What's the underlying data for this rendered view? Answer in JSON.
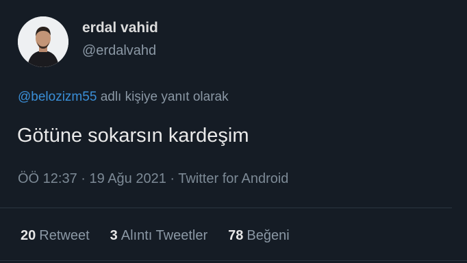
{
  "user": {
    "display_name": "erdal vahid",
    "handle": "@erdalvahd"
  },
  "reply": {
    "mention": "@belozizm55",
    "suffix": "adlı kişiye yanıt olarak"
  },
  "tweet": {
    "text": "Götüne sokarsın kardeşim",
    "meta": "ÖÖ 12:37 · 19 Ağu 2021 · Twitter for Android"
  },
  "stats": {
    "retweets_count": "20",
    "retweets_label": "Retweet",
    "quotes_count": "3",
    "quotes_label": "Alıntı Tweetler",
    "likes_count": "78",
    "likes_label": "Beğeni"
  },
  "colors": {
    "background": "#151c25",
    "mention": "#3a8fd8",
    "muted": "#8b98a5"
  },
  "icons": {
    "avatar": "profile-photo"
  }
}
